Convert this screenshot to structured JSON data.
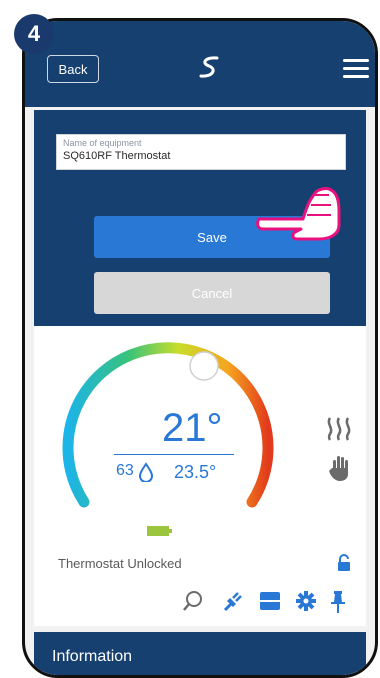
{
  "step": "4",
  "header": {
    "back_label": "Back",
    "logo_icon": "brand-s-logo-icon",
    "menu_icon": "hamburger-menu-icon"
  },
  "edit": {
    "field_label": "Name of equipment",
    "field_value": "SQ610RF Thermostat",
    "save_label": "Save",
    "cancel_label": "Cancel"
  },
  "thermostat": {
    "temperature": "21°",
    "humidity": "63",
    "current_temperature": "23.5°",
    "status": "Thermostat Unlocked",
    "icons": [
      "heating-icon",
      "manual-mode-icon",
      "battery-icon",
      "lock-icon",
      "search-icon",
      "plug-icon",
      "schedule-icon",
      "settings-icon",
      "pin-icon"
    ]
  },
  "footer": {
    "info_label": "Information"
  },
  "colors": {
    "primary": "#16406f",
    "accent": "#2a78d6",
    "highlight": "#e8117f"
  }
}
